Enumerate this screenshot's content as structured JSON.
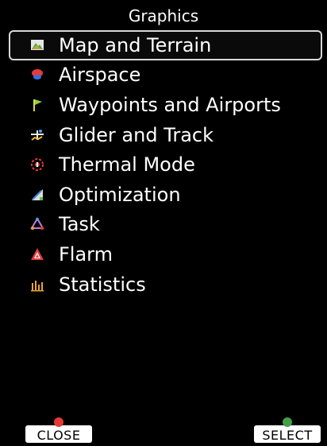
{
  "header": {
    "title": "Graphics"
  },
  "menu": {
    "items": [
      {
        "label": "Map and Terrain",
        "icon": "map-terrain-icon",
        "selected": true
      },
      {
        "label": "Airspace",
        "icon": "airspace-icon"
      },
      {
        "label": "Waypoints and Airports",
        "icon": "waypoint-flag-icon"
      },
      {
        "label": "Glider and Track",
        "icon": "glider-icon"
      },
      {
        "label": "Thermal Mode",
        "icon": "thermal-icon"
      },
      {
        "label": "Optimization",
        "icon": "optimization-icon"
      },
      {
        "label": "Task",
        "icon": "task-icon"
      },
      {
        "label": "Flarm",
        "icon": "flarm-icon"
      },
      {
        "label": "Statistics",
        "icon": "statistics-icon"
      }
    ]
  },
  "footer": {
    "close_label": "CLOSE",
    "select_label": "SELECT"
  },
  "colors": {
    "background": "#000000",
    "text": "#ffffff",
    "selection_border": "#d8d8d8",
    "close_badge": "#e53935",
    "select_badge": "#43a047"
  }
}
